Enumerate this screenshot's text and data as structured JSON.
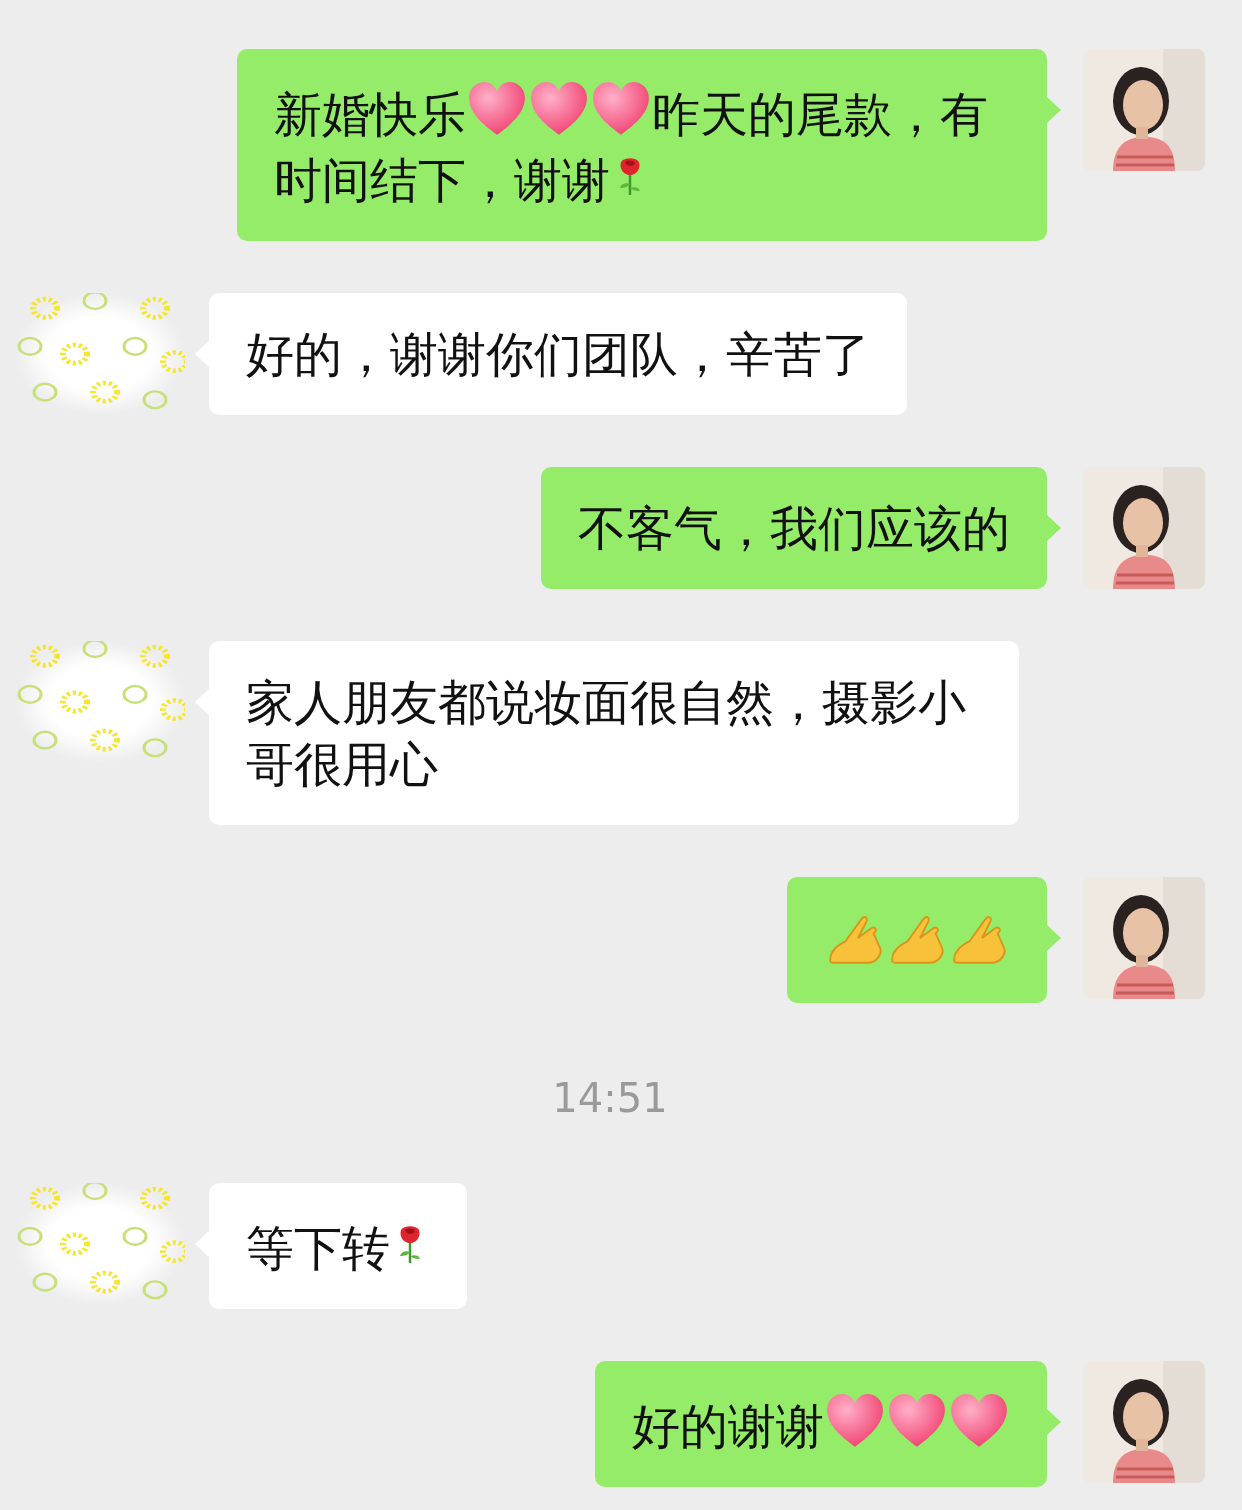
{
  "messages": [
    {
      "kind": "sent",
      "parts": [
        {
          "kind": "text",
          "text": "新婚快乐"
        },
        {
          "kind": "heart"
        },
        {
          "kind": "heart"
        },
        {
          "kind": "heart"
        },
        {
          "kind": "text",
          "text": "昨天的尾款，有时间结下，谢谢"
        },
        {
          "kind": "rose"
        }
      ]
    },
    {
      "kind": "received",
      "parts": [
        {
          "kind": "text",
          "text": "好的，谢谢你们团队，辛苦了"
        }
      ]
    },
    {
      "kind": "sent",
      "parts": [
        {
          "kind": "text",
          "text": "不客气，我们应该的"
        }
      ]
    },
    {
      "kind": "received",
      "parts": [
        {
          "kind": "text",
          "text": "家人朋友都说妆面很自然，摄影小哥很用心"
        }
      ]
    },
    {
      "kind": "sent",
      "parts": [
        {
          "kind": "hand"
        },
        {
          "kind": "hand"
        },
        {
          "kind": "hand"
        }
      ]
    },
    {
      "kind": "time",
      "text": "14:51"
    },
    {
      "kind": "received",
      "parts": [
        {
          "kind": "text",
          "text": "等下转"
        },
        {
          "kind": "rose"
        }
      ]
    },
    {
      "kind": "sent",
      "parts": [
        {
          "kind": "text",
          "text": "好的谢谢"
        },
        {
          "kind": "heart"
        },
        {
          "kind": "heart"
        },
        {
          "kind": "heart"
        }
      ]
    }
  ]
}
